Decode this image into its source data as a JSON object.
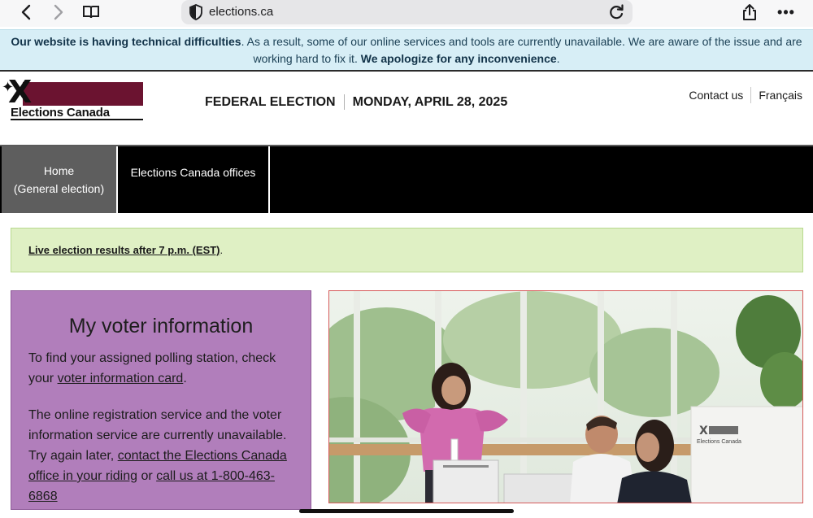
{
  "browser": {
    "url": "elections.ca",
    "icons": [
      "chevron-left-icon",
      "chevron-right-icon",
      "book-icon",
      "shield-icon",
      "reload-icon",
      "share-icon",
      "more-icon"
    ],
    "more_label": "•••"
  },
  "alert": {
    "bold_lead": "Our website is having technical difficulties",
    "text_1": ". As a result, some of our online services and tools are currently unavailable. We are aware of the issue and are working hard to fix it. ",
    "bold_apology": "We apologize for any inconvenience",
    "text_end": "."
  },
  "header": {
    "logo_text": "Elections Canada",
    "logo_mark": "X",
    "election_label": "FEDERAL ELECTION",
    "election_date": "MONDAY, APRIL 28, 2025",
    "links": {
      "contact": "Contact us",
      "language": "Français"
    },
    "colors": {
      "logo_bar": "#6b1330"
    }
  },
  "nav": {
    "home_line1": "Home",
    "home_line2": "(General election)",
    "offices": "Elections Canada offices"
  },
  "notice": {
    "link": "Live election results after 7 p.m. (EST)",
    "end": "."
  },
  "voter_card": {
    "title": "My voter information",
    "p1_text": "To find your assigned polling station, check your ",
    "p1_link": "voter information card",
    "p1_end": ".",
    "p2_text": "The online registration service and the voter information service are currently unavailable. Try again later, ",
    "p2_link1": "contact the Elections Canada office in your riding",
    "p2_mid": " or ",
    "p2_link2": "call us at 1-800-463-6868",
    "colors": {
      "background": "#b17ebb"
    }
  },
  "photo": {
    "booth_text": "Elections Canada",
    "booth_mark": "X"
  }
}
